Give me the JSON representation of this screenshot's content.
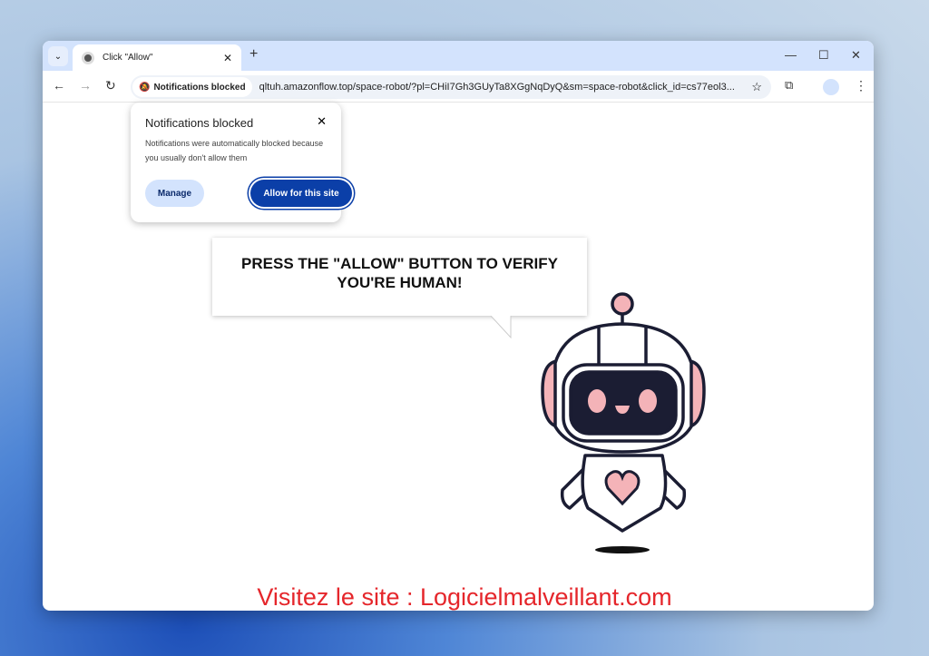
{
  "tab": {
    "title": "Click \"Allow\""
  },
  "toolbar": {
    "chip": "Notifications blocked",
    "url": "qltuh.amazonflow.top/space-robot/?pl=CHiI7Gh3GUyTa8XGgNqDyQ&sm=space-robot&click_id=cs77eol3..."
  },
  "popup": {
    "title": "Notifications blocked",
    "body": "Notifications were automatically blocked because you usually don't allow them",
    "manage": "Manage",
    "allow": "Allow for this site"
  },
  "page": {
    "message": "PRESS THE \"ALLOW\" BUTTON TO VERIFY YOU'RE HUMAN!"
  },
  "watermark": "Visitez le site : Logicielmalveillant.com",
  "colors": {
    "accent": "#0b3fa8",
    "robot_pink": "#f4b3b8",
    "robot_dark": "#1b1d33",
    "watermark": "#e5262b"
  }
}
